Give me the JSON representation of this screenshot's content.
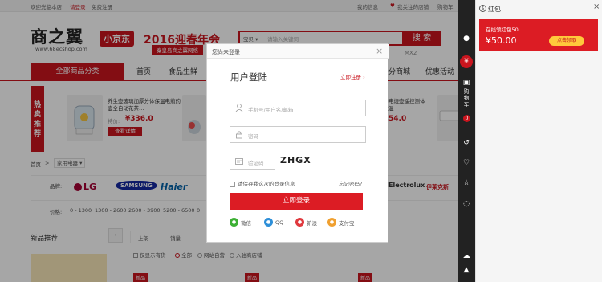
{
  "topbar": {
    "welcome": "欢迎光临本店!",
    "login": "请登录",
    "register": "免费注册",
    "my_info": "我的信息",
    "follow_shop": "我关注的店铺",
    "cart": "购物车"
  },
  "header": {
    "logo": "商之翼",
    "logo_url": "www.68ecshop.com",
    "badge": "小京东",
    "promo_title": "2016迎春年会",
    "promo_sub": "秦皇岛商之翼网络",
    "search_select": "宝贝",
    "search_placeholder": "请输入关键词",
    "search_button": "搜 索",
    "hotword": "MX2"
  },
  "nav": {
    "all_categories": "全部商品分类",
    "items": [
      "首页",
      "食品生鲜",
      "分商城",
      "优惠活动"
    ]
  },
  "hot": {
    "label": "热卖推荐",
    "product1_name": "养生壶玻璃加厚分体保温电煎药壶全自动花茶…",
    "product1_old": "特价:",
    "product1_price": "¥336.0",
    "product1_btn": "查看详情",
    "product3_name": "电烧壶遥控测体温",
    "product3_price": "54.0"
  },
  "crumb": {
    "home": "首页",
    "sep": ">",
    "category": "家用电器"
  },
  "brands": {
    "label": "品牌:",
    "items": [
      "LG",
      "SAMSUNG",
      "Haier",
      "Electrolux",
      "伊莱克斯"
    ]
  },
  "prices": {
    "label": "价格:",
    "ranges": [
      "0 - 1300",
      "1300 - 2600",
      "2600 - 3900",
      "5200 - 6500",
      "0"
    ]
  },
  "bottom": {
    "section_title": "新品推荐",
    "sort": [
      "上架",
      "销量"
    ],
    "filters": [
      "仅显示有货",
      "全部",
      "网站自营",
      "入驻商店铺"
    ],
    "new_tag": "新品"
  },
  "modal": {
    "head": "您尚未登录",
    "close": "×",
    "title": "用户登陆",
    "register_link": "立即注册",
    "username_placeholder": "手机号/用户名/邮箱",
    "password_placeholder": "密码",
    "captcha_placeholder": "验证码",
    "captcha_code": "ZHGX",
    "remember": "请保存我这次的登录信息",
    "forgot": "忘记密码？",
    "login_button": "立即登录",
    "social": [
      "微信",
      "QQ",
      "新浪",
      "支付宝"
    ]
  },
  "panel": {
    "title": "红包",
    "close": "×",
    "coupon_line": "在线领红包50",
    "coupon_amount": "¥50.00",
    "coupon_button": "点击领取",
    "cart_label": "购物车",
    "cart_count": "0"
  },
  "colors": {
    "brand_red": "#c9151e",
    "button_red": "#dc1c24",
    "coupon_button": "#ffc93c",
    "side_bar": "#222222"
  }
}
